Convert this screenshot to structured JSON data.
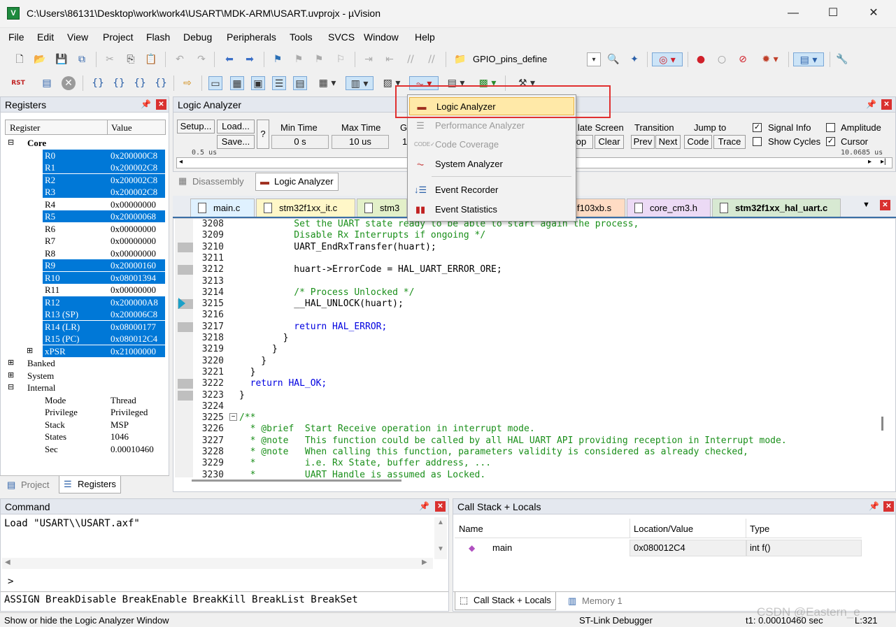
{
  "window": {
    "title": "C:\\Users\\86131\\Desktop\\work\\work4\\USART\\MDK-ARM\\USART.uvprojx - µVision",
    "minimize": "—",
    "maximize": "☐",
    "close": "✕"
  },
  "menu": [
    "File",
    "Edit",
    "View",
    "Project",
    "Flash",
    "Debug",
    "Peripherals",
    "Tools",
    "SVCS",
    "Window",
    "Help"
  ],
  "toolbar": {
    "define_combo": "GPIO_pins_define"
  },
  "registers": {
    "title": "Registers",
    "col_register": "Register",
    "col_value": "Value",
    "groups": {
      "core": "Core",
      "banked": "Banked",
      "system": "System",
      "internal": "Internal"
    },
    "core": [
      {
        "name": "R0",
        "value": "0x200000C8",
        "hl": true
      },
      {
        "name": "R1",
        "value": "0x200002C8",
        "hl": true
      },
      {
        "name": "R2",
        "value": "0x200002C8",
        "hl": true
      },
      {
        "name": "R3",
        "value": "0x200002C8",
        "hl": true
      },
      {
        "name": "R4",
        "value": "0x00000000",
        "hl": false
      },
      {
        "name": "R5",
        "value": "0x20000068",
        "hl": true
      },
      {
        "name": "R6",
        "value": "0x00000000",
        "hl": false
      },
      {
        "name": "R7",
        "value": "0x00000000",
        "hl": false
      },
      {
        "name": "R8",
        "value": "0x00000000",
        "hl": false
      },
      {
        "name": "R9",
        "value": "0x20000160",
        "hl": true
      },
      {
        "name": "R10",
        "value": "0x08001394",
        "hl": true
      },
      {
        "name": "R11",
        "value": "0x00000000",
        "hl": false
      },
      {
        "name": "R12",
        "value": "0x200000A8",
        "hl": true
      },
      {
        "name": "R13 (SP)",
        "value": "0x200006C8",
        "hl": true
      },
      {
        "name": "R14 (LR)",
        "value": "0x08000177",
        "hl": true
      },
      {
        "name": "R15 (PC)",
        "value": "0x080012C4",
        "hl": true
      },
      {
        "name": "xPSR",
        "value": "0x21000000",
        "hl": true
      }
    ],
    "internal": [
      {
        "name": "Mode",
        "value": "Thread"
      },
      {
        "name": "Privilege",
        "value": "Privileged"
      },
      {
        "name": "Stack",
        "value": "MSP"
      },
      {
        "name": "States",
        "value": "1046"
      },
      {
        "name": "Sec",
        "value": "0.00010460"
      }
    ],
    "tab_project": "Project",
    "tab_registers": "Registers"
  },
  "logic": {
    "title": "Logic Analyzer",
    "setup": "Setup...",
    "load": "Load...",
    "save": "Save...",
    "q": "?",
    "min_time_label": "Min Time",
    "min_time": "0 s",
    "max_time_label": "Max Time",
    "max_time": "10 us",
    "g_label": "G",
    "g_value": "1",
    "update_label": "late Screen",
    "op": "op",
    "clear": "Clear",
    "transition": "Transition",
    "prev": "Prev",
    "next": "Next",
    "jump_to": "Jump to",
    "code": "Code",
    "trace": "Trace",
    "signal_info": "Signal Info",
    "show_cycles": "Show Cycles",
    "amplitude": "Amplitude",
    "cursor": "Cursor",
    "scale_left": "0.5 us",
    "scale_right": "10.0685 us"
  },
  "editor_tabs_top": {
    "disassembly": "Disassembly",
    "logic": "Logic Analyzer"
  },
  "file_tabs": [
    "main.c",
    "stm32f1xx_it.c",
    "stm3",
    "f103xb.s",
    "core_cm3.h",
    "stm32f1xx_hal_uart.c"
  ],
  "code": [
    {
      "ln": "3208",
      "text": "          Set the UART state ready to be able to start again the process,",
      "cls": "cm",
      "gm": false
    },
    {
      "ln": "3209",
      "text": "          Disable Rx Interrupts if ongoing */",
      "cls": "cm",
      "gm": false
    },
    {
      "ln": "3210",
      "text": "          UART_EndRxTransfer(huart);",
      "cls": "",
      "gm": true
    },
    {
      "ln": "3211",
      "text": "",
      "cls": "",
      "gm": false
    },
    {
      "ln": "3212",
      "text": "          huart->ErrorCode = HAL_UART_ERROR_ORE;",
      "cls": "",
      "gm": true
    },
    {
      "ln": "3213",
      "text": "",
      "cls": "",
      "gm": false
    },
    {
      "ln": "3214",
      "text": "          /* Process Unlocked */",
      "cls": "cm",
      "gm": false
    },
    {
      "ln": "3215",
      "text": "          __HAL_UNLOCK(huart);",
      "cls": "",
      "gm": true
    },
    {
      "ln": "3216",
      "text": "",
      "cls": "",
      "gm": false
    },
    {
      "ln": "3217",
      "text": "          return HAL_ERROR;",
      "cls": "ret",
      "gm": true
    },
    {
      "ln": "3218",
      "text": "        }",
      "cls": "",
      "gm": false
    },
    {
      "ln": "3219",
      "text": "      }",
      "cls": "",
      "gm": false
    },
    {
      "ln": "3220",
      "text": "    }",
      "cls": "",
      "gm": false
    },
    {
      "ln": "3221",
      "text": "  }",
      "cls": "",
      "gm": false
    },
    {
      "ln": "3222",
      "text": "  return HAL_OK;",
      "cls": "ret",
      "gm": true
    },
    {
      "ln": "3223",
      "text": "}",
      "cls": "",
      "gm": true
    },
    {
      "ln": "3224",
      "text": "",
      "cls": "",
      "gm": false
    },
    {
      "ln": "3225",
      "text": "/**",
      "cls": "cm",
      "gm": false
    },
    {
      "ln": "3226",
      "text": "  * @brief  Start Receive operation in interrupt mode.",
      "cls": "cm",
      "gm": false
    },
    {
      "ln": "3227",
      "text": "  * @note   This function could be called by all HAL UART API providing reception in Interrupt mode.",
      "cls": "cm",
      "gm": false
    },
    {
      "ln": "3228",
      "text": "  * @note   When calling this function, parameters validity is considered as already checked,",
      "cls": "cm",
      "gm": false
    },
    {
      "ln": "3229",
      "text": "  *         i.e. Rx State, buffer address, ...",
      "cls": "cm",
      "gm": false
    },
    {
      "ln": "3230",
      "text": "  *         UART Handle is assumed as Locked.",
      "cls": "cm",
      "gm": false
    }
  ],
  "analysis_menu": [
    {
      "label": "Logic Analyzer",
      "state": "active"
    },
    {
      "label": "Performance Analyzer",
      "state": "disabled"
    },
    {
      "label": "Code Coverage",
      "state": "disabled"
    },
    {
      "label": "System Analyzer",
      "state": "normal"
    },
    {
      "label": "Event Recorder",
      "state": "normal"
    },
    {
      "label": "Event Statistics",
      "state": "normal"
    }
  ],
  "command": {
    "title": "Command",
    "output": "Load \"USART\\\\USART.axf\"",
    "prompt": ">",
    "hints": "ASSIGN BreakDisable BreakEnable BreakKill BreakList BreakSet"
  },
  "callstack": {
    "title": "Call Stack + Locals",
    "col_name": "Name",
    "col_loc": "Location/Value",
    "col_type": "Type",
    "row": {
      "name": "main",
      "loc": "0x080012C4",
      "type": "int f()"
    },
    "tab_callstack": "Call Stack + Locals",
    "tab_memory": "Memory 1"
  },
  "status": {
    "hint": "Show or hide the Logic Analyzer Window",
    "debugger": "ST-Link Debugger",
    "time": "t1: 0.00010460 sec",
    "line": "L:321",
    "watermark": "CSDN @Eastern_e"
  },
  "colors": {
    "selection": "#0078d7",
    "highlight_box": "#e03030",
    "menu_active": "#ffe9a8"
  }
}
